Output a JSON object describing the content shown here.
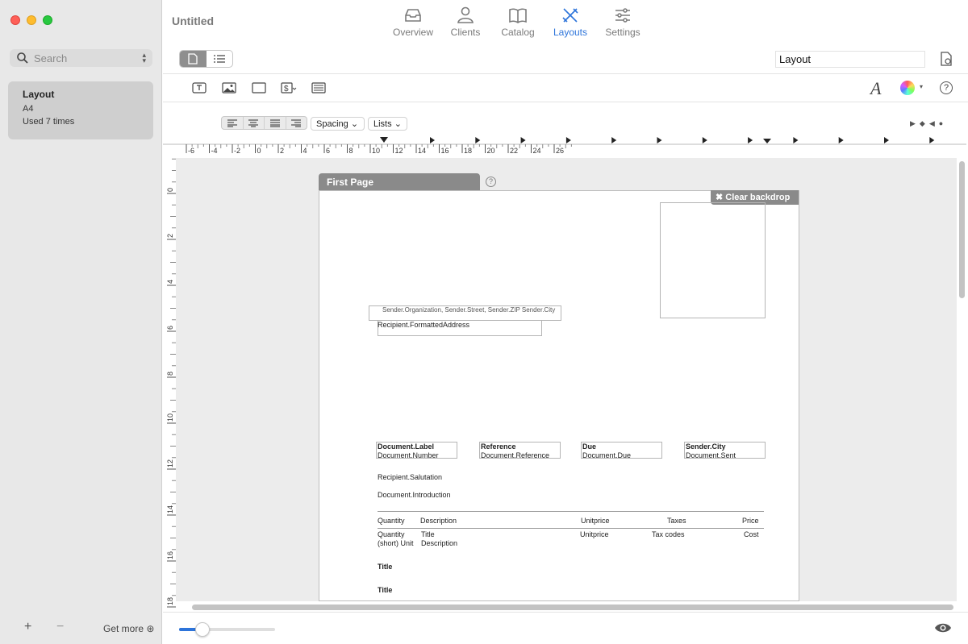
{
  "window": {
    "title": "Untitled"
  },
  "sidebar": {
    "search_placeholder": "Search",
    "layouts": [
      {
        "name": "Layout",
        "format": "A4",
        "usage": "Used 7 times"
      }
    ],
    "add_label": "+",
    "remove_label": "−",
    "get_more_label": "Get more"
  },
  "tabs": [
    {
      "label": "Overview",
      "icon": "tray-icon"
    },
    {
      "label": "Clients",
      "icon": "person-icon"
    },
    {
      "label": "Catalog",
      "icon": "book-icon"
    },
    {
      "label": "Layouts",
      "icon": "pen-ruler-icon",
      "active": true
    },
    {
      "label": "Settings",
      "icon": "sliders-icon"
    }
  ],
  "accent_color": "#2d74da",
  "layout_name_value": "Layout",
  "format_bar": {
    "spacing_label": "Spacing",
    "lists_label": "Lists"
  },
  "ruler": {
    "horizontal_labels": [
      "-6",
      "-4",
      "-2",
      "0",
      "2",
      "4",
      "6",
      "8",
      "10",
      "12",
      "14",
      "16",
      "18",
      "20",
      "22",
      "24",
      "26"
    ],
    "vertical_labels": [
      "0",
      "2",
      "4",
      "6",
      "8",
      "10",
      "12",
      "14",
      "16",
      "18"
    ]
  },
  "page": {
    "tab_label": "First Page",
    "help_label": "?",
    "clear_backdrop_label": "✖ Clear backdrop",
    "sender_line": "Sender.Organization, Sender.Street, Sender.ZIP Sender.City",
    "recipient_address": "Recipient.FormattedAddress",
    "info_fields": [
      {
        "label": "Document.Label",
        "value": "Document.Number"
      },
      {
        "label": "Reference",
        "value": "Document.Reference"
      },
      {
        "label": "Due",
        "value": "Document.Due"
      },
      {
        "label": "Sender.City",
        "value": "Document.Sent"
      }
    ],
    "salutation": "Recipient.Salutation",
    "introduction": "Document.Introduction",
    "table_headers": {
      "quantity": "Quantity",
      "description": "Description",
      "unitprice": "Unitprice",
      "taxes": "Taxes",
      "price": "Price"
    },
    "table_row": {
      "quantity": "Quantity",
      "unit": "(short) Unit",
      "title": "Title",
      "description": "Description",
      "unitprice": "Unitprice",
      "tax_codes": "Tax codes",
      "cost": "Cost"
    },
    "section_titles": [
      "Title",
      "Title"
    ]
  },
  "zoom_value": 0.24
}
